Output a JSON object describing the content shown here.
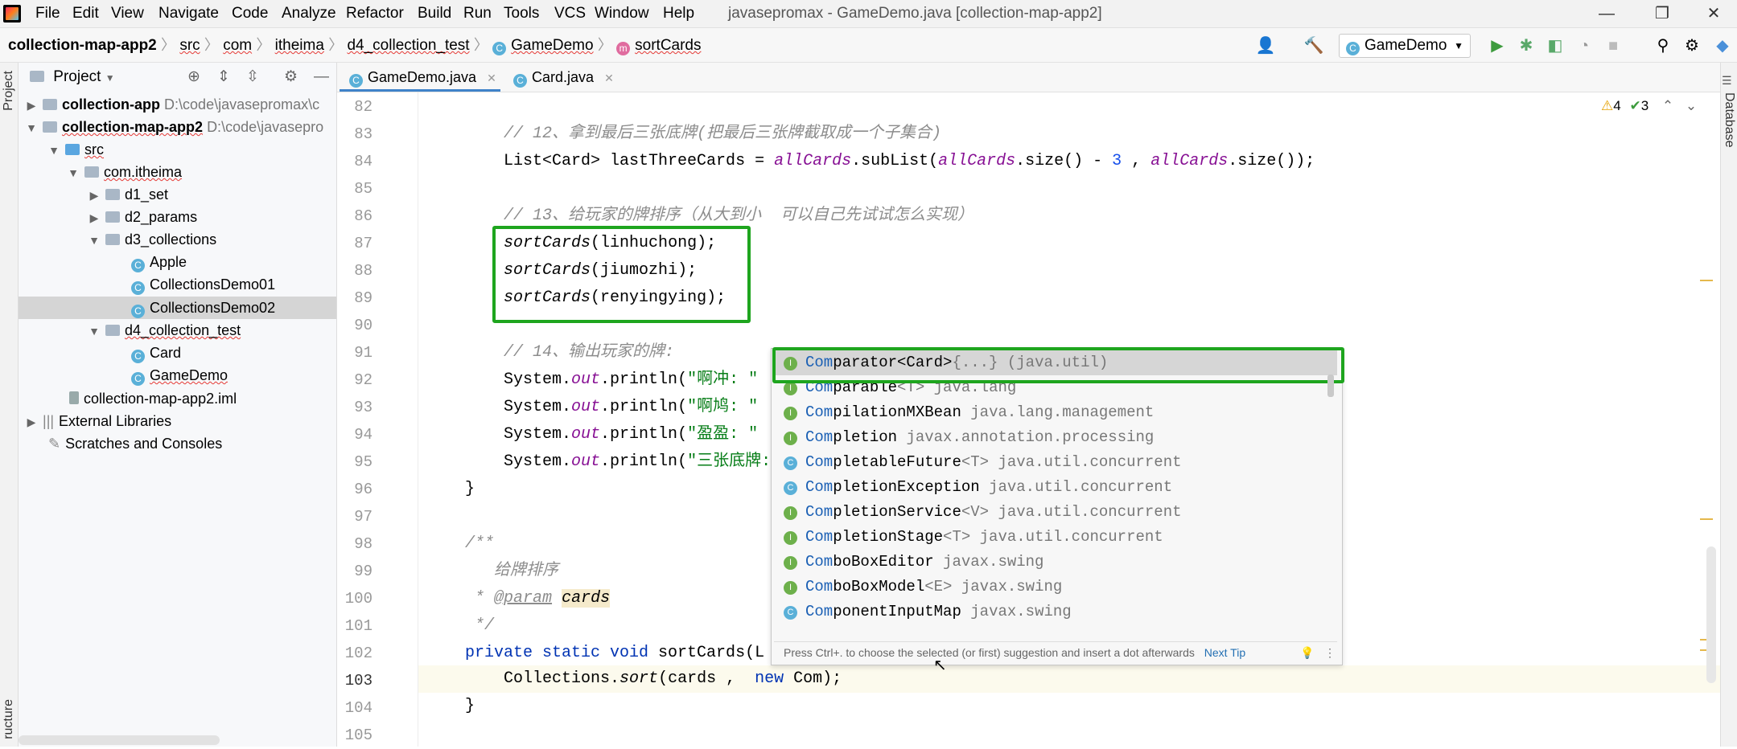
{
  "title_bar": {
    "menus": [
      "File",
      "Edit",
      "View",
      "Navigate",
      "Code",
      "Analyze",
      "Refactor",
      "Build",
      "Run",
      "Tools",
      "VCS",
      "Window",
      "Help"
    ],
    "window_title": "javasepromax - GameDemo.java [collection-map-app2]",
    "minimize": "—",
    "restore": "❐",
    "close": "✕"
  },
  "breadcrumbs": [
    "collection-map-app2",
    "src",
    "com",
    "itheima",
    "d4_collection_test",
    "GameDemo",
    "sortCards"
  ],
  "toolbar": {
    "run_config": "GameDemo",
    "icons": [
      "user-icon",
      "build-hammer-icon",
      "run-icon",
      "debug-icon",
      "coverage-icon",
      "profile-icon",
      "stop-icon",
      "search-icon",
      "settings-icon",
      "plugin-icon"
    ]
  },
  "left_stripe": {
    "project_label": "Project",
    "structure_label": "ructure"
  },
  "project_panel": {
    "header": "Project",
    "items": [
      {
        "name": "collection-app",
        "path": "D:\\code\\javasepromax\\c"
      },
      {
        "name": "collection-map-app2",
        "path": "D:\\code\\javasepro"
      },
      {
        "name": "src"
      },
      {
        "name": "com.itheima"
      },
      {
        "name": "d1_set"
      },
      {
        "name": "d2_params"
      },
      {
        "name": "d3_collections"
      },
      {
        "name": "Apple"
      },
      {
        "name": "CollectionsDemo01"
      },
      {
        "name": "CollectionsDemo02"
      },
      {
        "name": "d4_collection_test"
      },
      {
        "name": "Card"
      },
      {
        "name": "GameDemo"
      },
      {
        "name": "collection-map-app2.iml"
      },
      {
        "name": "External Libraries"
      },
      {
        "name": "Scratches and Consoles"
      }
    ]
  },
  "editor_tabs": [
    {
      "label": "GameDemo.java",
      "active": true
    },
    {
      "label": "Card.java",
      "active": false
    }
  ],
  "inspections": {
    "warnings": "4",
    "weak_warnings": "3"
  },
  "line_numbers": [
    "82",
    "83",
    "84",
    "85",
    "86",
    "87",
    "88",
    "89",
    "90",
    "91",
    "92",
    "93",
    "94",
    "95",
    "96",
    "97",
    "98",
    "99",
    "100",
    "101",
    "102",
    "103",
    "104",
    "105"
  ],
  "code": {
    "l83": "// 12、拿到最后三张底牌(把最后三张牌截取成一个子集合)",
    "l84_a": "List<Card> lastThreeCards = ",
    "l84_b": "allCards",
    "l84_c": ".subList(",
    "l84_d": "allCards",
    "l84_e": ".size() - ",
    "l84_f": "3",
    "l84_g": " , ",
    "l84_h": "allCards",
    "l84_i": ".size());",
    "l86": "// 13、给玩家的牌排序（从大到小  可以自己先试试怎么实现）",
    "l87_a": "sortCards",
    "l87_b": "(linhuchong);",
    "l88_a": "sortCards",
    "l88_b": "(jiumozhi);",
    "l89_a": "sortCards",
    "l89_b": "(renyingying);",
    "l91": "// 14、输出玩家的牌:",
    "sys": "System.",
    "out": "out",
    "println": ".println(",
    "s92": "\"啊冲: \"",
    "s93": "\"啊鸠: \"",
    "s94": "\"盈盈: \"",
    "s95": "\"三张底牌:",
    "l96": "}",
    "l98": "/**",
    "l99": "给牌排序",
    "l100_star": "* ",
    "l100_tag": "@param",
    "l100_param": "cards",
    "l101": "*/",
    "l102_kw": "private static void ",
    "l102_rest": "sortCards(L",
    "l103_a": "Collections.",
    "l103_b": "sort",
    "l103_c": "(cards ,  ",
    "l103_kw": "new",
    "l103_d": " Com);",
    "l104": "}"
  },
  "completion": {
    "items": [
      {
        "match": "Com",
        "rest": "parator<Card>",
        "extra": "{...} (java.util)",
        "kind": "I"
      },
      {
        "match": "Com",
        "rest": "parable",
        "extra": "<T> java.lang",
        "kind": "I"
      },
      {
        "match": "Com",
        "rest": "pilationMXBean",
        "extra": " java.lang.management",
        "kind": "I"
      },
      {
        "match": "Com",
        "rest": "pletion",
        "extra": " javax.annotation.processing",
        "kind": "I"
      },
      {
        "match": "Com",
        "rest": "pletableFuture",
        "extra": "<T> java.util.concurrent",
        "kind": "C"
      },
      {
        "match": "Com",
        "rest": "pletionException",
        "extra": " java.util.concurrent",
        "kind": "C"
      },
      {
        "match": "Com",
        "rest": "pletionService",
        "extra": "<V> java.util.concurrent",
        "kind": "I"
      },
      {
        "match": "Com",
        "rest": "pletionStage",
        "extra": "<T> java.util.concurrent",
        "kind": "I"
      },
      {
        "match": "Com",
        "rest": "boBoxEditor",
        "extra": " javax.swing",
        "kind": "I"
      },
      {
        "match": "Com",
        "rest": "boBoxModel",
        "extra": "<E> javax.swing",
        "kind": "I"
      },
      {
        "match": "Com",
        "rest": "ponentInputMap",
        "extra": " javax.swing",
        "kind": "C"
      }
    ],
    "footer_hint": "Press Ctrl+. to choose the selected (or first) suggestion and insert a dot afterwards",
    "next_tip": "Next Tip"
  },
  "right_stripe": {
    "database_label": "Database"
  },
  "colors": {
    "highlight_green": "#1ea51e",
    "keyword": "#0033b3",
    "field": "#871094",
    "string": "#067d17"
  }
}
